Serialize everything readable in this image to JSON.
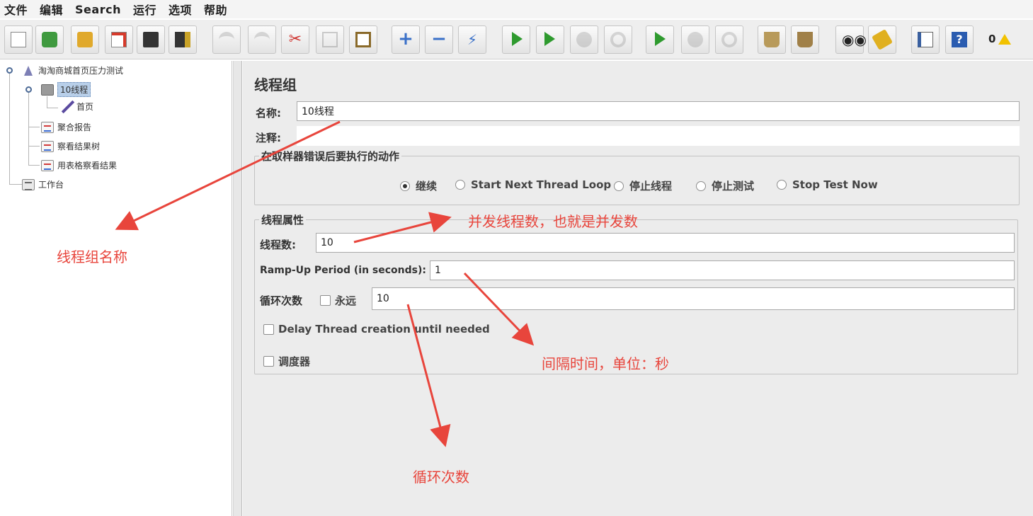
{
  "menu": [
    "文件",
    "编辑",
    "Search",
    "运行",
    "选项",
    "帮助"
  ],
  "toolbar": {
    "buttons": [
      {
        "name": "new-icon",
        "color": "#ffffff"
      },
      {
        "name": "templates-icon",
        "color": "#3f9a3f"
      },
      {
        "name": "open-icon",
        "color": "#e0a92c"
      },
      {
        "name": "close-icon",
        "color": "#d63a2b"
      },
      {
        "name": "save-icon",
        "color": "#333333"
      },
      {
        "name": "save-as-icon",
        "color": "#8a5a1e"
      },
      {
        "name": "undo-icon",
        "color": "#b0b0b0"
      },
      {
        "name": "redo-icon",
        "color": "#b0b0b0"
      },
      {
        "name": "cut-icon",
        "color": "#d0312d"
      },
      {
        "name": "copy-icon",
        "color": "#b0b0b0"
      },
      {
        "name": "paste-icon",
        "color": "#8a6a2a"
      },
      {
        "name": "expand-icon",
        "color": "#3a70c8"
      },
      {
        "name": "collapse-icon",
        "color": "#3a70c8"
      },
      {
        "name": "toggle-icon",
        "color": "#3a70c8"
      },
      {
        "name": "start-icon",
        "color": "#2e9a2e"
      },
      {
        "name": "start-no-pause-icon",
        "color": "#2e9a2e"
      },
      {
        "name": "stop-icon",
        "color": "#b0b0b0"
      },
      {
        "name": "shutdown-icon",
        "color": "#b0b0b0"
      },
      {
        "name": "remote-start-icon",
        "color": "#2e9a2e"
      },
      {
        "name": "remote-stop-icon",
        "color": "#b0b0b0"
      },
      {
        "name": "remote-shutdown-icon",
        "color": "#b0b0b0"
      },
      {
        "name": "clear-icon",
        "color": "#9a7a3a"
      },
      {
        "name": "clear-all-icon",
        "color": "#9a7a3a"
      },
      {
        "name": "search-icon",
        "color": "#333333"
      },
      {
        "name": "reset-search-icon",
        "color": "#e0b020"
      },
      {
        "name": "function-helper-icon",
        "color": "#3a60a0"
      },
      {
        "name": "help-icon",
        "color": "#2a5cb0"
      }
    ],
    "error_count": "0"
  },
  "tree": {
    "test_plan": "淘淘商城首页压力测试",
    "thread_group": "10线程",
    "sampler": "首页",
    "listeners": [
      "聚合报告",
      "察看结果树",
      "用表格察看结果"
    ],
    "workbench": "工作台"
  },
  "form": {
    "title": "线程组",
    "name_label": "名称:",
    "name_value": "10线程",
    "comment_label": "注释:",
    "comment_value": "",
    "error_action_legend": "在取样器错误后要执行的动作",
    "error_actions": [
      {
        "label": "继续",
        "selected": true
      },
      {
        "label": "Start Next Thread Loop",
        "selected": false
      },
      {
        "label": "停止线程",
        "selected": false
      },
      {
        "label": "停止测试",
        "selected": false
      },
      {
        "label": "Stop Test Now",
        "selected": false
      }
    ],
    "thread_props_legend": "线程属性",
    "threads_label": "线程数:",
    "threads_value": "10",
    "rampup_label": "Ramp-Up Period (in seconds):",
    "rampup_value": "1",
    "loop_label": "循环次数",
    "forever_label": "永远",
    "forever_checked": false,
    "loop_value": "10",
    "delay_label": "Delay Thread creation until needed",
    "delay_checked": false,
    "scheduler_label": "调度器",
    "scheduler_checked": false
  },
  "annotations": {
    "group_name": "线程组名称",
    "concurrency": "并发线程数，也就是并发数",
    "interval": "间隔时间，单位：秒",
    "loops": "循环次数",
    "color": "#e8453c"
  }
}
